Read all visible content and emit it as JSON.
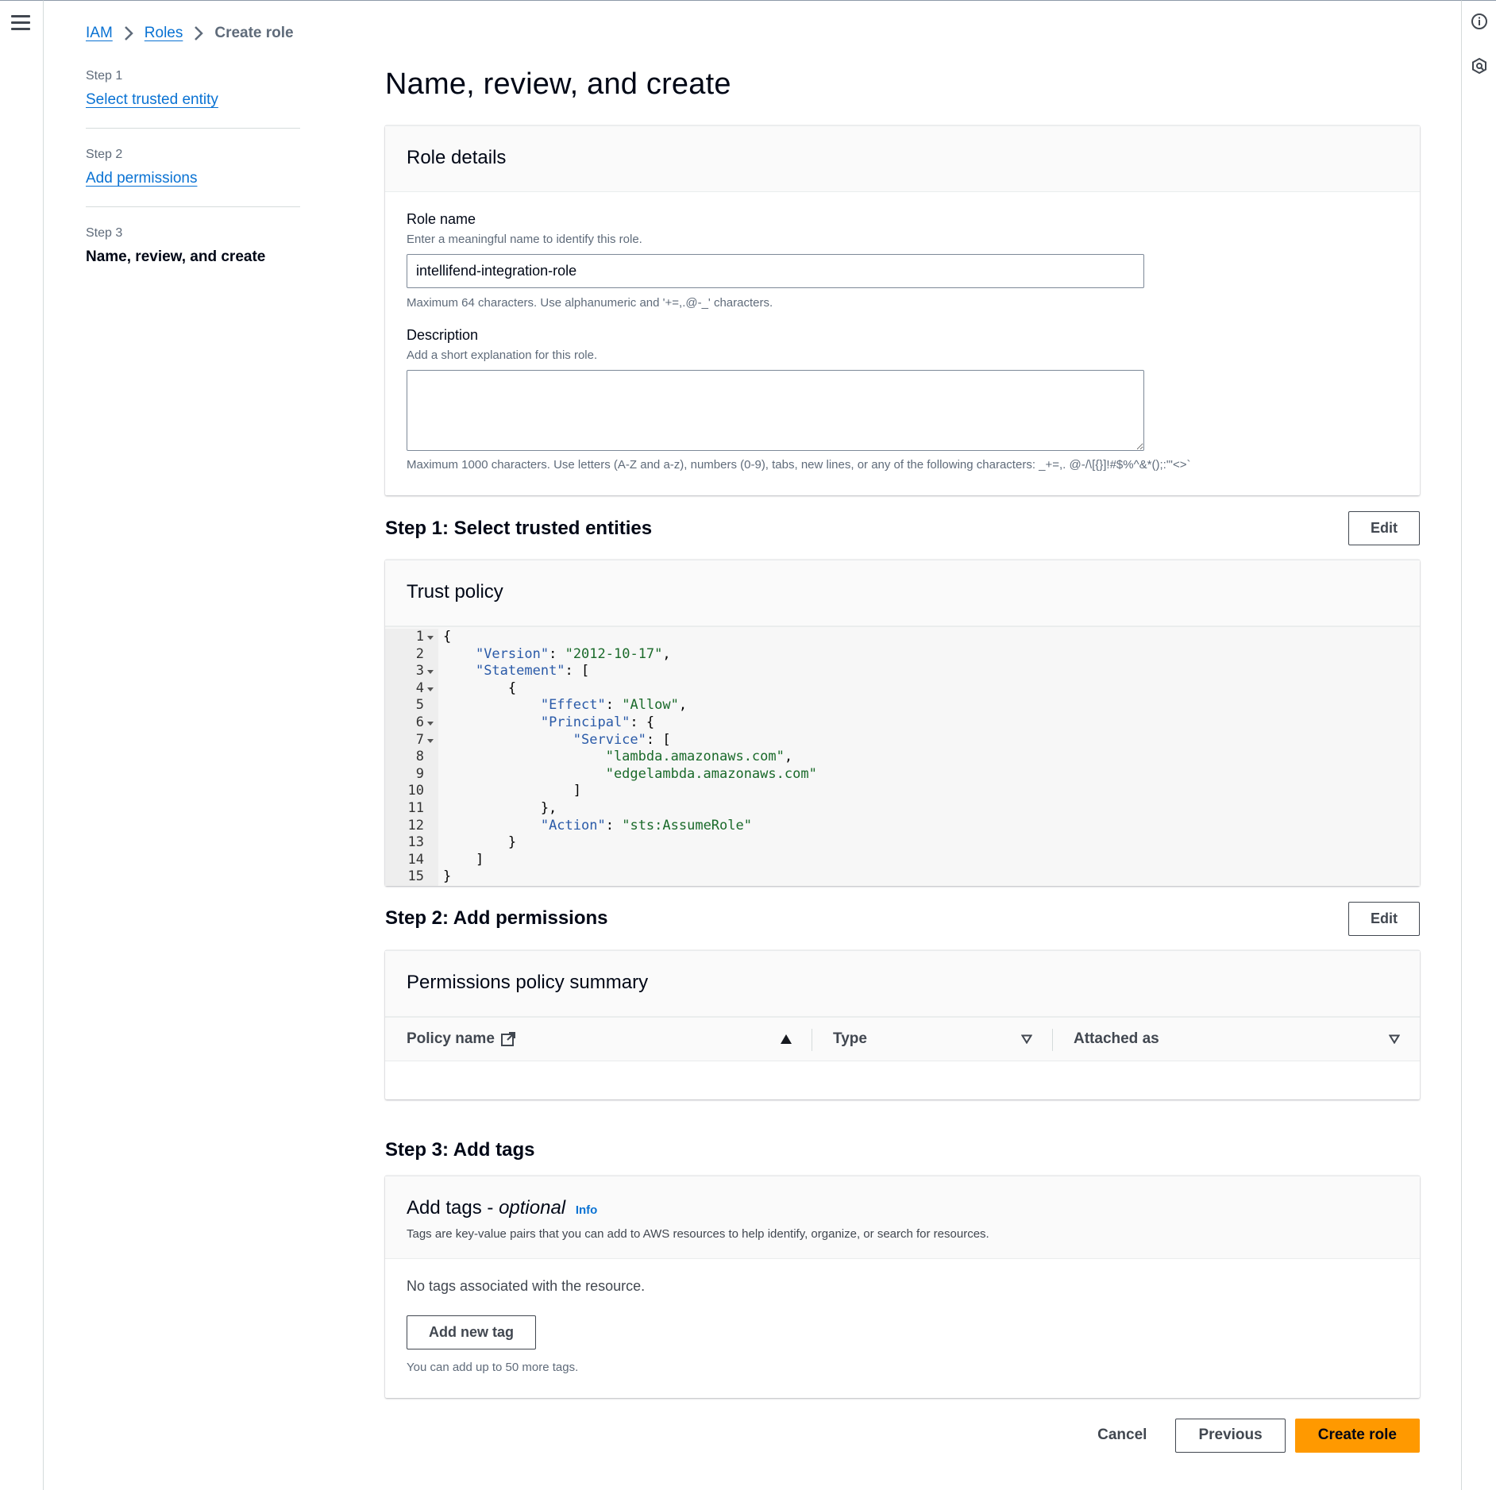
{
  "breadcrumb": {
    "items": [
      "IAM",
      "Roles"
    ],
    "current": "Create role"
  },
  "steps": [
    {
      "label": "Step 1",
      "name": "Select trusted entity"
    },
    {
      "label": "Step 2",
      "name": "Add permissions"
    },
    {
      "label": "Step 3",
      "name": "Name, review, and create"
    }
  ],
  "page_title": "Name, review, and create",
  "role_details": {
    "title": "Role details",
    "role_name_label": "Role name",
    "role_name_desc": "Enter a meaningful name to identify this role.",
    "role_name_value": "intellifend-integration-role",
    "role_name_constraint": "Maximum 64 characters. Use alphanumeric and '+=,.@-_' characters.",
    "description_label": "Description",
    "description_desc": "Add a short explanation for this role.",
    "description_value": "",
    "description_constraint": "Maximum 1000 characters. Use letters (A-Z and a-z), numbers (0-9), tabs, new lines, or any of the following characters: _+=,. @-/\\[{}]!#$%^&*();:\"'<>`"
  },
  "step1": {
    "title": "Step 1: Select trusted entities",
    "edit_label": "Edit",
    "panel_title": "Trust policy",
    "code_lines": [
      "{",
      "    \"Version\": \"2012-10-17\",",
      "    \"Statement\": [",
      "        {",
      "            \"Effect\": \"Allow\",",
      "            \"Principal\": {",
      "                \"Service\": [",
      "                    \"lambda.amazonaws.com\",",
      "                    \"edgelambda.amazonaws.com\"",
      "                ]",
      "            },",
      "            \"Action\": \"sts:AssumeRole\"",
      "        }",
      "    ]",
      "}"
    ],
    "line_numbers": [
      "1",
      "2",
      "3",
      "4",
      "5",
      "6",
      "7",
      "8",
      "9",
      "10",
      "11",
      "12",
      "13",
      "14",
      "15"
    ]
  },
  "step2": {
    "title": "Step 2: Add permissions",
    "edit_label": "Edit",
    "panel_title": "Permissions policy summary",
    "columns": [
      "Policy name",
      "Type",
      "Attached as"
    ]
  },
  "step3": {
    "title": "Step 3: Add tags",
    "panel_title": "Add tags - ",
    "panel_title_optional": "optional",
    "info_label": "Info",
    "desc": "Tags are key-value pairs that you can add to AWS resources to help identify, organize, or search for resources.",
    "no_tags": "No tags associated with the resource.",
    "add_tag_label": "Add new tag",
    "tag_hint": "You can add up to 50 more tags."
  },
  "actions": {
    "cancel": "Cancel",
    "previous": "Previous",
    "create": "Create role"
  },
  "colors": {
    "link": "#0972d3",
    "primary": "#ff9900"
  }
}
